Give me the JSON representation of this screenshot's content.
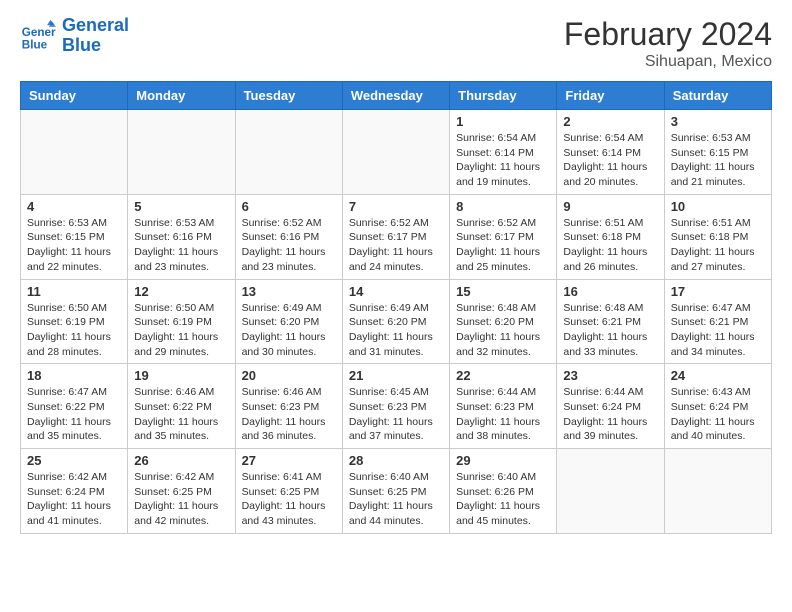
{
  "logo": {
    "line1": "General",
    "line2": "Blue"
  },
  "title": "February 2024",
  "subtitle": "Sihuapan, Mexico",
  "days_of_week": [
    "Sunday",
    "Monday",
    "Tuesday",
    "Wednesday",
    "Thursday",
    "Friday",
    "Saturday"
  ],
  "weeks": [
    [
      {
        "num": "",
        "info": ""
      },
      {
        "num": "",
        "info": ""
      },
      {
        "num": "",
        "info": ""
      },
      {
        "num": "",
        "info": ""
      },
      {
        "num": "1",
        "info": "Sunrise: 6:54 AM\nSunset: 6:14 PM\nDaylight: 11 hours and 19 minutes."
      },
      {
        "num": "2",
        "info": "Sunrise: 6:54 AM\nSunset: 6:14 PM\nDaylight: 11 hours and 20 minutes."
      },
      {
        "num": "3",
        "info": "Sunrise: 6:53 AM\nSunset: 6:15 PM\nDaylight: 11 hours and 21 minutes."
      }
    ],
    [
      {
        "num": "4",
        "info": "Sunrise: 6:53 AM\nSunset: 6:15 PM\nDaylight: 11 hours and 22 minutes."
      },
      {
        "num": "5",
        "info": "Sunrise: 6:53 AM\nSunset: 6:16 PM\nDaylight: 11 hours and 23 minutes."
      },
      {
        "num": "6",
        "info": "Sunrise: 6:52 AM\nSunset: 6:16 PM\nDaylight: 11 hours and 23 minutes."
      },
      {
        "num": "7",
        "info": "Sunrise: 6:52 AM\nSunset: 6:17 PM\nDaylight: 11 hours and 24 minutes."
      },
      {
        "num": "8",
        "info": "Sunrise: 6:52 AM\nSunset: 6:17 PM\nDaylight: 11 hours and 25 minutes."
      },
      {
        "num": "9",
        "info": "Sunrise: 6:51 AM\nSunset: 6:18 PM\nDaylight: 11 hours and 26 minutes."
      },
      {
        "num": "10",
        "info": "Sunrise: 6:51 AM\nSunset: 6:18 PM\nDaylight: 11 hours and 27 minutes."
      }
    ],
    [
      {
        "num": "11",
        "info": "Sunrise: 6:50 AM\nSunset: 6:19 PM\nDaylight: 11 hours and 28 minutes."
      },
      {
        "num": "12",
        "info": "Sunrise: 6:50 AM\nSunset: 6:19 PM\nDaylight: 11 hours and 29 minutes."
      },
      {
        "num": "13",
        "info": "Sunrise: 6:49 AM\nSunset: 6:20 PM\nDaylight: 11 hours and 30 minutes."
      },
      {
        "num": "14",
        "info": "Sunrise: 6:49 AM\nSunset: 6:20 PM\nDaylight: 11 hours and 31 minutes."
      },
      {
        "num": "15",
        "info": "Sunrise: 6:48 AM\nSunset: 6:20 PM\nDaylight: 11 hours and 32 minutes."
      },
      {
        "num": "16",
        "info": "Sunrise: 6:48 AM\nSunset: 6:21 PM\nDaylight: 11 hours and 33 minutes."
      },
      {
        "num": "17",
        "info": "Sunrise: 6:47 AM\nSunset: 6:21 PM\nDaylight: 11 hours and 34 minutes."
      }
    ],
    [
      {
        "num": "18",
        "info": "Sunrise: 6:47 AM\nSunset: 6:22 PM\nDaylight: 11 hours and 35 minutes."
      },
      {
        "num": "19",
        "info": "Sunrise: 6:46 AM\nSunset: 6:22 PM\nDaylight: 11 hours and 35 minutes."
      },
      {
        "num": "20",
        "info": "Sunrise: 6:46 AM\nSunset: 6:23 PM\nDaylight: 11 hours and 36 minutes."
      },
      {
        "num": "21",
        "info": "Sunrise: 6:45 AM\nSunset: 6:23 PM\nDaylight: 11 hours and 37 minutes."
      },
      {
        "num": "22",
        "info": "Sunrise: 6:44 AM\nSunset: 6:23 PM\nDaylight: 11 hours and 38 minutes."
      },
      {
        "num": "23",
        "info": "Sunrise: 6:44 AM\nSunset: 6:24 PM\nDaylight: 11 hours and 39 minutes."
      },
      {
        "num": "24",
        "info": "Sunrise: 6:43 AM\nSunset: 6:24 PM\nDaylight: 11 hours and 40 minutes."
      }
    ],
    [
      {
        "num": "25",
        "info": "Sunrise: 6:42 AM\nSunset: 6:24 PM\nDaylight: 11 hours and 41 minutes."
      },
      {
        "num": "26",
        "info": "Sunrise: 6:42 AM\nSunset: 6:25 PM\nDaylight: 11 hours and 42 minutes."
      },
      {
        "num": "27",
        "info": "Sunrise: 6:41 AM\nSunset: 6:25 PM\nDaylight: 11 hours and 43 minutes."
      },
      {
        "num": "28",
        "info": "Sunrise: 6:40 AM\nSunset: 6:25 PM\nDaylight: 11 hours and 44 minutes."
      },
      {
        "num": "29",
        "info": "Sunrise: 6:40 AM\nSunset: 6:26 PM\nDaylight: 11 hours and 45 minutes."
      },
      {
        "num": "",
        "info": ""
      },
      {
        "num": "",
        "info": ""
      }
    ]
  ]
}
